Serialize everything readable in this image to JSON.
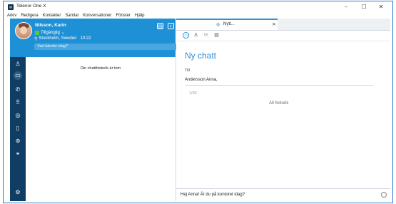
{
  "window": {
    "title": "Telenor One X",
    "minimize": "–",
    "maximize": "☐",
    "close": "✕"
  },
  "menu": [
    "Arkiv",
    "Redigera",
    "Kontakter",
    "Samtal",
    "Konversationer",
    "Fönster",
    "Hjälp"
  ],
  "profile": {
    "name": "Nilsson, Karin",
    "status": "Tillgänglig",
    "location": "Stockholm, Sweden",
    "time": "10:22",
    "mood_placeholder": "Vad händer idag?"
  },
  "history": {
    "empty_text": "Din chatthistorik är tom"
  },
  "tab": {
    "label": "Nytt..."
  },
  "chat": {
    "title": "Ny chatt",
    "to_label": "Till",
    "to_value": "Andersson Anna,",
    "char_count": "1/30",
    "all_history": "All historik",
    "compose_text": "Hej Anna! Är du på kontoret idag?"
  },
  "colors": {
    "accent": "#1e90d6",
    "rail": "#0f3d64",
    "status_available": "#5fc638"
  },
  "icons": {
    "rail": [
      "contacts-icon",
      "chat-icon",
      "call-history-icon",
      "dialpad-icon",
      "globe-icon",
      "phone-transfer-icon",
      "voicemail-icon",
      "link-icon",
      "settings-icon"
    ]
  }
}
